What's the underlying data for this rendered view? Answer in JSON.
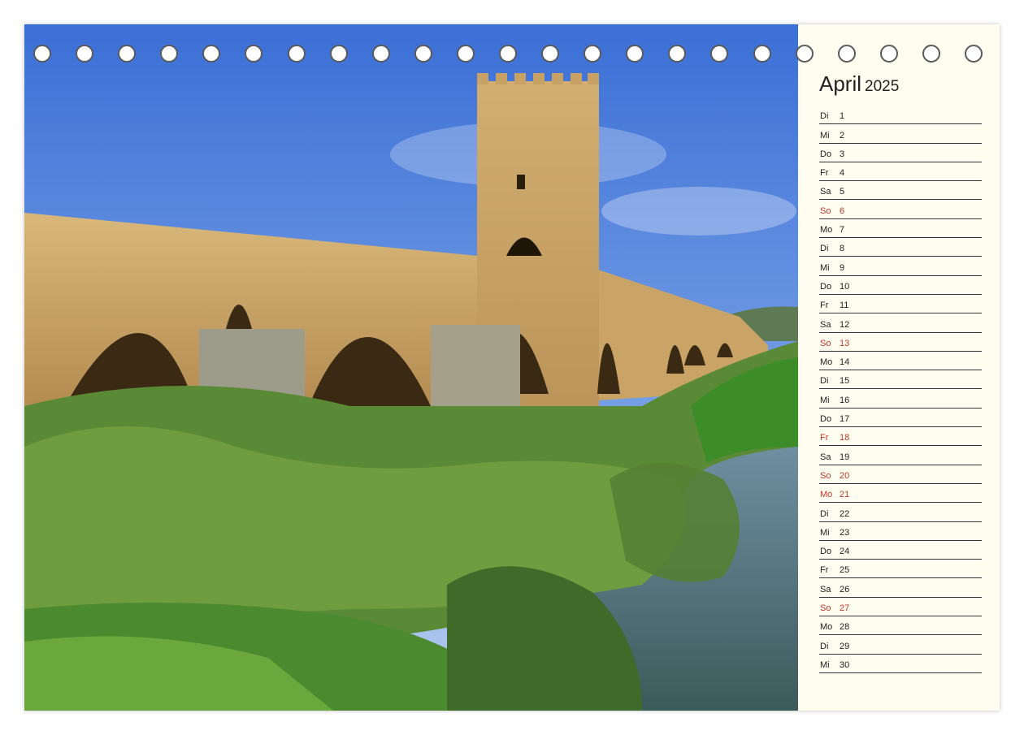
{
  "calendar": {
    "month": "April",
    "year": "2025",
    "days": [
      {
        "weekday": "Di",
        "day": "1",
        "holiday": false
      },
      {
        "weekday": "Mi",
        "day": "2",
        "holiday": false
      },
      {
        "weekday": "Do",
        "day": "3",
        "holiday": false
      },
      {
        "weekday": "Fr",
        "day": "4",
        "holiday": false
      },
      {
        "weekday": "Sa",
        "day": "5",
        "holiday": false
      },
      {
        "weekday": "So",
        "day": "6",
        "holiday": true
      },
      {
        "weekday": "Mo",
        "day": "7",
        "holiday": false
      },
      {
        "weekday": "Di",
        "day": "8",
        "holiday": false
      },
      {
        "weekday": "Mi",
        "day": "9",
        "holiday": false
      },
      {
        "weekday": "Do",
        "day": "10",
        "holiday": false
      },
      {
        "weekday": "Fr",
        "day": "11",
        "holiday": false
      },
      {
        "weekday": "Sa",
        "day": "12",
        "holiday": false
      },
      {
        "weekday": "So",
        "day": "13",
        "holiday": true
      },
      {
        "weekday": "Mo",
        "day": "14",
        "holiday": false
      },
      {
        "weekday": "Di",
        "day": "15",
        "holiday": false
      },
      {
        "weekday": "Mi",
        "day": "16",
        "holiday": false
      },
      {
        "weekday": "Do",
        "day": "17",
        "holiday": false
      },
      {
        "weekday": "Fr",
        "day": "18",
        "holiday": true
      },
      {
        "weekday": "Sa",
        "day": "19",
        "holiday": false
      },
      {
        "weekday": "So",
        "day": "20",
        "holiday": true
      },
      {
        "weekday": "Mo",
        "day": "21",
        "holiday": true
      },
      {
        "weekday": "Di",
        "day": "22",
        "holiday": false
      },
      {
        "weekday": "Mi",
        "day": "23",
        "holiday": false
      },
      {
        "weekday": "Do",
        "day": "24",
        "holiday": false
      },
      {
        "weekday": "Fr",
        "day": "25",
        "holiday": false
      },
      {
        "weekday": "Sa",
        "day": "26",
        "holiday": false
      },
      {
        "weekday": "So",
        "day": "27",
        "holiday": true
      },
      {
        "weekday": "Mo",
        "day": "28",
        "holiday": false
      },
      {
        "weekday": "Di",
        "day": "29",
        "holiday": false
      },
      {
        "weekday": "Mi",
        "day": "30",
        "holiday": false
      }
    ]
  },
  "colors": {
    "holiday": "#c0392b",
    "text": "#222222",
    "paper": "#fffdf0"
  },
  "binding": {
    "ring_count": 23
  }
}
